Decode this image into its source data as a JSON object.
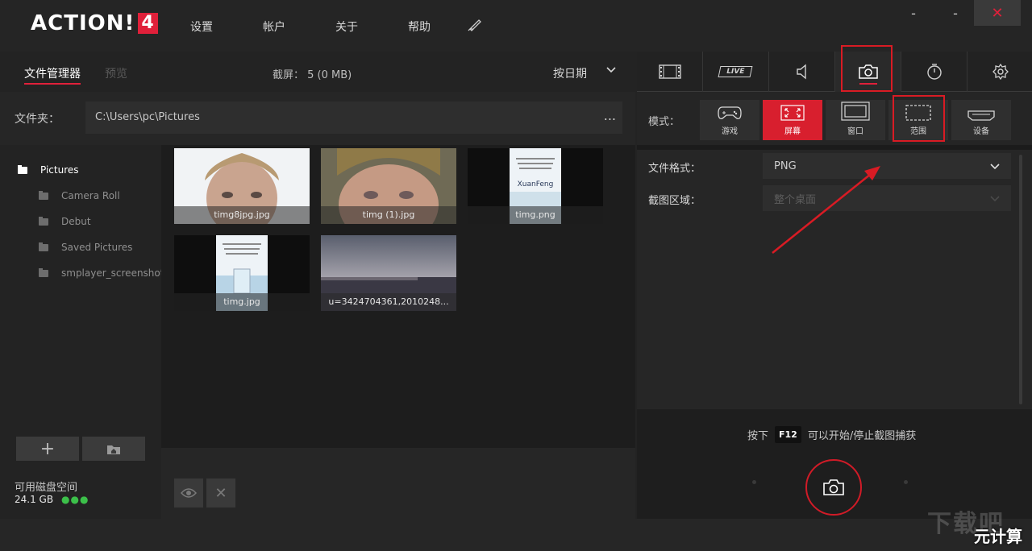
{
  "app": {
    "logo_text": "ACTION!",
    "logo_version": "4"
  },
  "menu": [
    "设置",
    "帐户",
    "关于",
    "帮助"
  ],
  "window": {
    "minimize": "-",
    "maximize": "-",
    "close": "✕"
  },
  "left": {
    "tabs": {
      "files": "文件管理器",
      "preview": "预览"
    },
    "capture_count": "截屏： 5 (0 MB)",
    "sort_label": "按日期",
    "folder_label": "文件夹：",
    "folder_path": "C:\\Users\\pc\\Pictures",
    "folder_more": "...",
    "tree": [
      "Pictures",
      "Camera Roll",
      "Debut",
      "Saved Pictures",
      "smplayer_screenshots"
    ],
    "thumbnails": [
      "timg8jpg.jpg",
      "timg (1).jpg",
      "timg.png",
      "timg.jpg",
      "u=3424704361,2010248..."
    ],
    "thumb_text": {
      "xuanfeng": "XuanFeng"
    },
    "disk_label": "可用磁盘空间",
    "disk_value": "24.1 GB",
    "disk_dots": "●●●"
  },
  "right": {
    "tabs": [
      "video-tab",
      "live-tab",
      "audio-tab",
      "screenshot-tab",
      "timer-tab",
      "settings-tab"
    ],
    "live_label": "LIVE",
    "mode_label": "模式：",
    "modes": [
      "游戏",
      "屏幕",
      "窗口",
      "范围",
      "设备"
    ],
    "format_label": "文件格式：",
    "format_value": "PNG",
    "area_label": "截图区域：",
    "area_value": "整个桌面",
    "hint_before": "按下",
    "hint_key": "F12",
    "hint_after": "可以开始/停止截图捕获"
  },
  "watermark": {
    "top": "下载吧",
    "bottom": "元计算"
  },
  "colors": {
    "accent": "#e0203a",
    "annotation": "#d91b24",
    "disk_ok": "#3cc04a"
  }
}
